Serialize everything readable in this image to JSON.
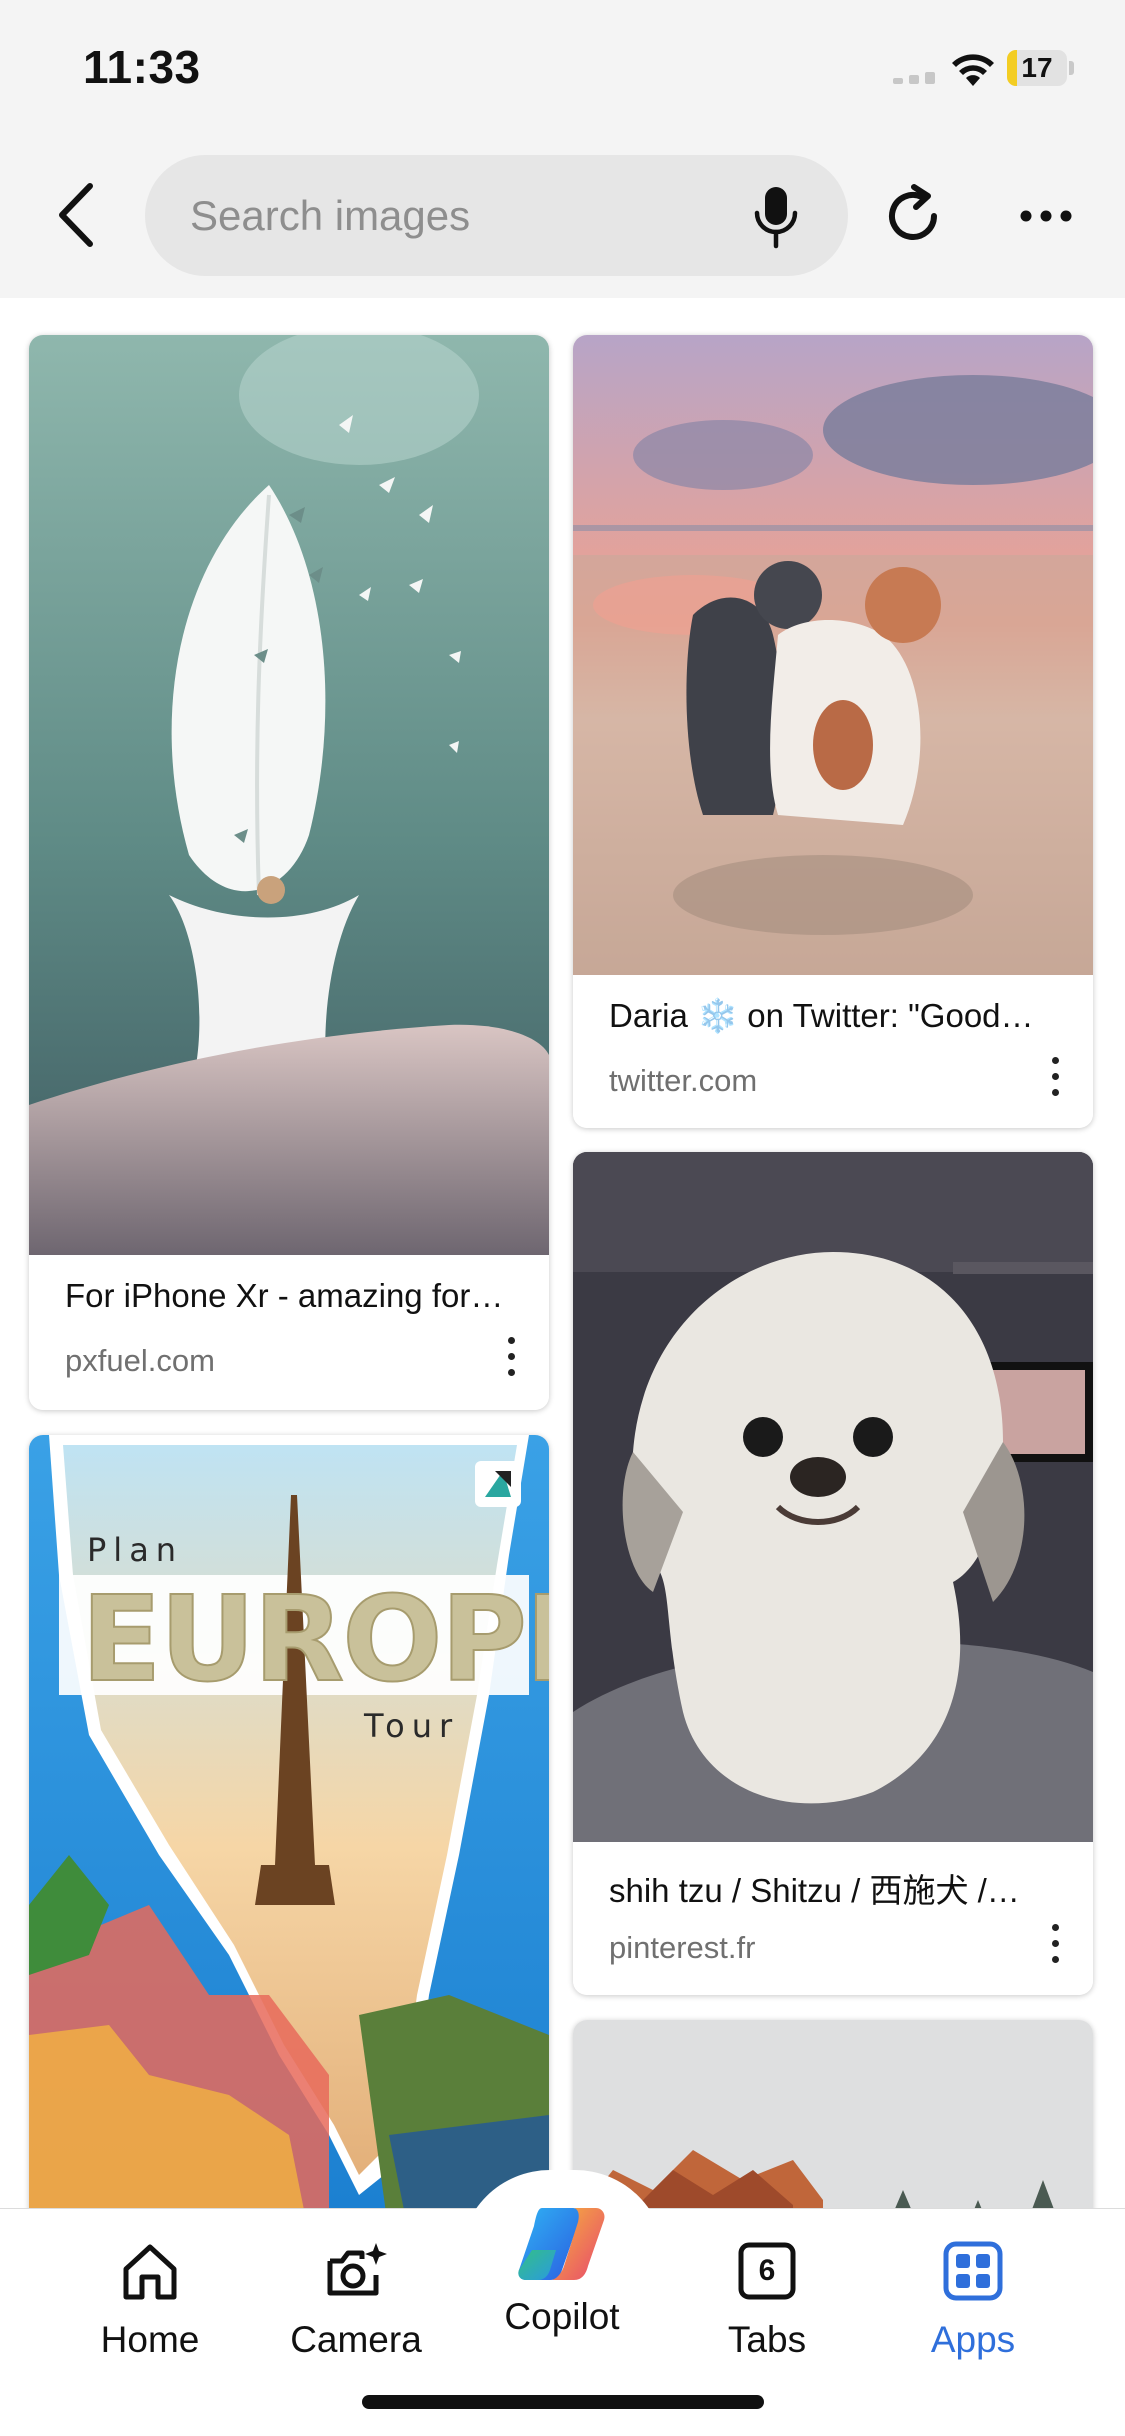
{
  "status_bar": {
    "time": "11:33",
    "battery": "17",
    "battery_level": 0.17
  },
  "search": {
    "placeholder": "Search images"
  },
  "results": [
    {
      "caption": "For iPhone Xr - amazing for…",
      "source": "pxfuel.com"
    },
    {
      "caption": "Daria ❄️ on Twitter: \"Good…",
      "source": "twitter.com"
    },
    {
      "caption": "shih tzu / Shitzu / 西施犬 /…",
      "source": "pinterest.fr"
    }
  ],
  "poster": {
    "plan": "Plan",
    "title": "EUROPE",
    "tour": "Tour"
  },
  "nav": [
    {
      "label": "Home",
      "icon": "home-icon"
    },
    {
      "label": "Camera",
      "icon": "camera-icon"
    },
    {
      "label": "Copilot",
      "icon": "copilot-icon"
    },
    {
      "label": "Tabs",
      "icon": "tabs-icon",
      "count": "6"
    },
    {
      "label": "Apps",
      "icon": "apps-icon",
      "active": true
    }
  ],
  "colors": {
    "accent": "#2f6fdb",
    "battery": "#f3cd23"
  }
}
